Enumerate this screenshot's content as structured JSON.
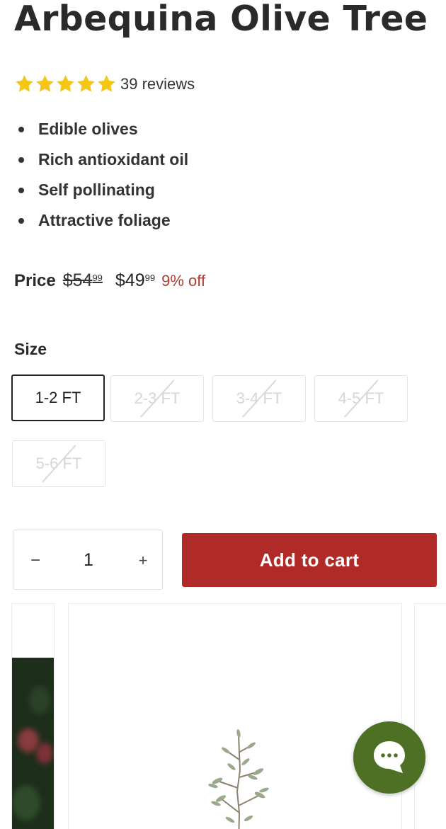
{
  "product": {
    "title": "Arbequina Olive Tree",
    "rating": 5,
    "reviews_label": "39 reviews",
    "features": [
      "Edible olives",
      "Rich antioxidant oil",
      "Self pollinating",
      "Attractive foliage"
    ]
  },
  "price": {
    "label": "Price",
    "old_dollars": "$54",
    "old_cents": "99",
    "new_dollars": "$49",
    "new_cents": "99",
    "discount": "9% off"
  },
  "sizes": {
    "label": "Size",
    "options": [
      {
        "label": "1-2 FT",
        "state": "selected"
      },
      {
        "label": "2-3 FT",
        "state": "unavailable"
      },
      {
        "label": "3-4 FT",
        "state": "unavailable"
      },
      {
        "label": "4-5 FT",
        "state": "unavailable"
      },
      {
        "label": "5-6 FT",
        "state": "unavailable"
      }
    ]
  },
  "quantity": {
    "minus_symbol": "−",
    "value": "1",
    "plus_symbol": "+"
  },
  "cart": {
    "button_label": "Add to cart"
  },
  "chat": {
    "icon": "chat-bubble-icon"
  },
  "colors": {
    "star": "#f5c518",
    "discount": "#b03a34",
    "cart_button": "#b02a27",
    "chat_button": "#4e7024"
  }
}
